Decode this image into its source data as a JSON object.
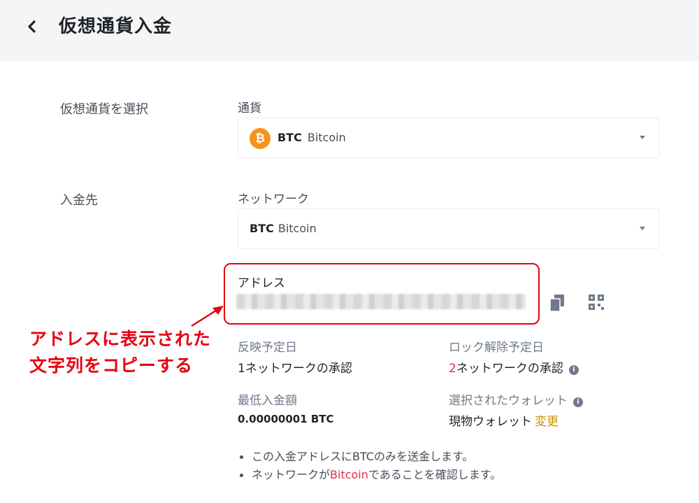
{
  "header": {
    "title": "仮想通貨入金"
  },
  "currency_section": {
    "label": "仮想通貨を選択",
    "field_label": "通貨",
    "selected_symbol": "BTC",
    "selected_name": "Bitcoin",
    "coin_glyph": "₿"
  },
  "destination_section": {
    "label": "入金先",
    "network_label": "ネットワーク",
    "network_symbol": "BTC",
    "network_name": "Bitcoin",
    "address_label": "アドレス"
  },
  "annotation": {
    "line1": "アドレスに表示された",
    "line2": "文字列をコピーする",
    "color": "#e60012"
  },
  "info": {
    "arrival_label": "反映予定日",
    "arrival_num": "1",
    "arrival_text": "ネットワークの承認",
    "unlock_label": "ロック解除予定日",
    "unlock_num": "2",
    "unlock_text": "ネットワークの承認",
    "min_label": "最低入金額",
    "min_value": "0.00000001 BTC",
    "wallet_label": "選択されたウォレット",
    "wallet_value": "現物ウォレット",
    "wallet_change": "変更",
    "info_glyph": "i"
  },
  "notes": {
    "note1": "この入金アドレスにBTCのみを送金します。",
    "note2_pre": "ネットワークが",
    "note2_link": "Bitcoin",
    "note2_post": "であることを確認します。"
  },
  "colors": {
    "accent_gold": "#c99400",
    "red": "#e02d4c",
    "btc_orange": "#f7931a"
  }
}
